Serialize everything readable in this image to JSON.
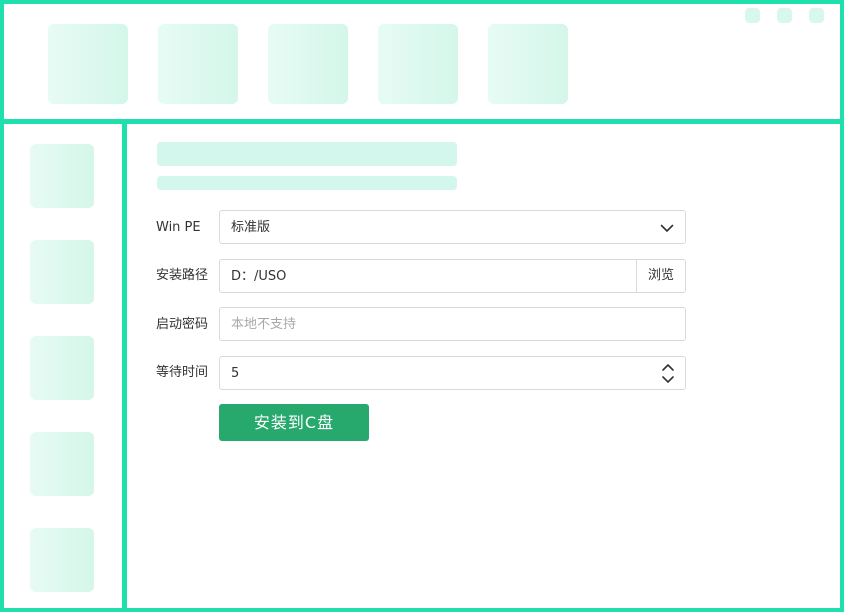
{
  "form": {
    "winpe": {
      "label": "Win PE",
      "value": "标准版"
    },
    "install_path": {
      "label": "安装路径",
      "value": "D：/USO",
      "browse_label": "浏览"
    },
    "boot_password": {
      "label": "启动密码",
      "placeholder": "本地不支持"
    },
    "wait_time": {
      "label": "等待时间",
      "value": "5"
    },
    "install_button": "安装到C盘"
  },
  "colors": {
    "frame": "#1fe0ac",
    "button": "#27a86c",
    "tile": "#dcf8ee"
  },
  "icons": [
    "chevron-down-icon",
    "spinner-up-icon",
    "spinner-down-icon"
  ]
}
